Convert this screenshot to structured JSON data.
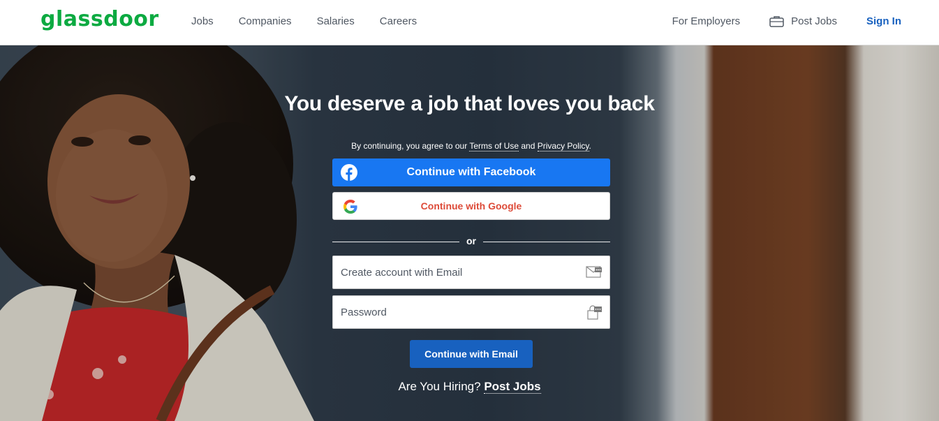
{
  "colors": {
    "brand": "#0caa41",
    "facebook": "#1877f2",
    "google_text": "#dd4b39",
    "primary_button": "#1861bf",
    "nav_text": "#505863"
  },
  "nav": {
    "logo": "glassdoor",
    "links": [
      "Jobs",
      "Companies",
      "Salaries",
      "Careers"
    ],
    "for_employers": "For Employers",
    "post_jobs": "Post Jobs",
    "post_jobs_icon": "briefcase-icon",
    "sign_in": "Sign In"
  },
  "hero": {
    "headline": "You deserve a job that loves you back",
    "terms": {
      "prefix": "By continuing, you agree to our ",
      "terms_link": "Terms of Use",
      "middle": " and ",
      "privacy_link": "Privacy Policy",
      "suffix": "."
    },
    "facebook_button": "Continue with Facebook",
    "facebook_icon": "facebook-icon",
    "google_button": "Continue with Google",
    "google_icon": "google-icon",
    "divider_text": "or",
    "email_field": {
      "placeholder": "Create account with Email",
      "value": "",
      "icon": "email-autofill-icon"
    },
    "password_field": {
      "placeholder": "Password",
      "value": "",
      "icon": "password-autofill-icon"
    },
    "email_button": "Continue with Email",
    "hiring_prompt": "Are You Hiring?",
    "hiring_link": "Post Jobs"
  }
}
